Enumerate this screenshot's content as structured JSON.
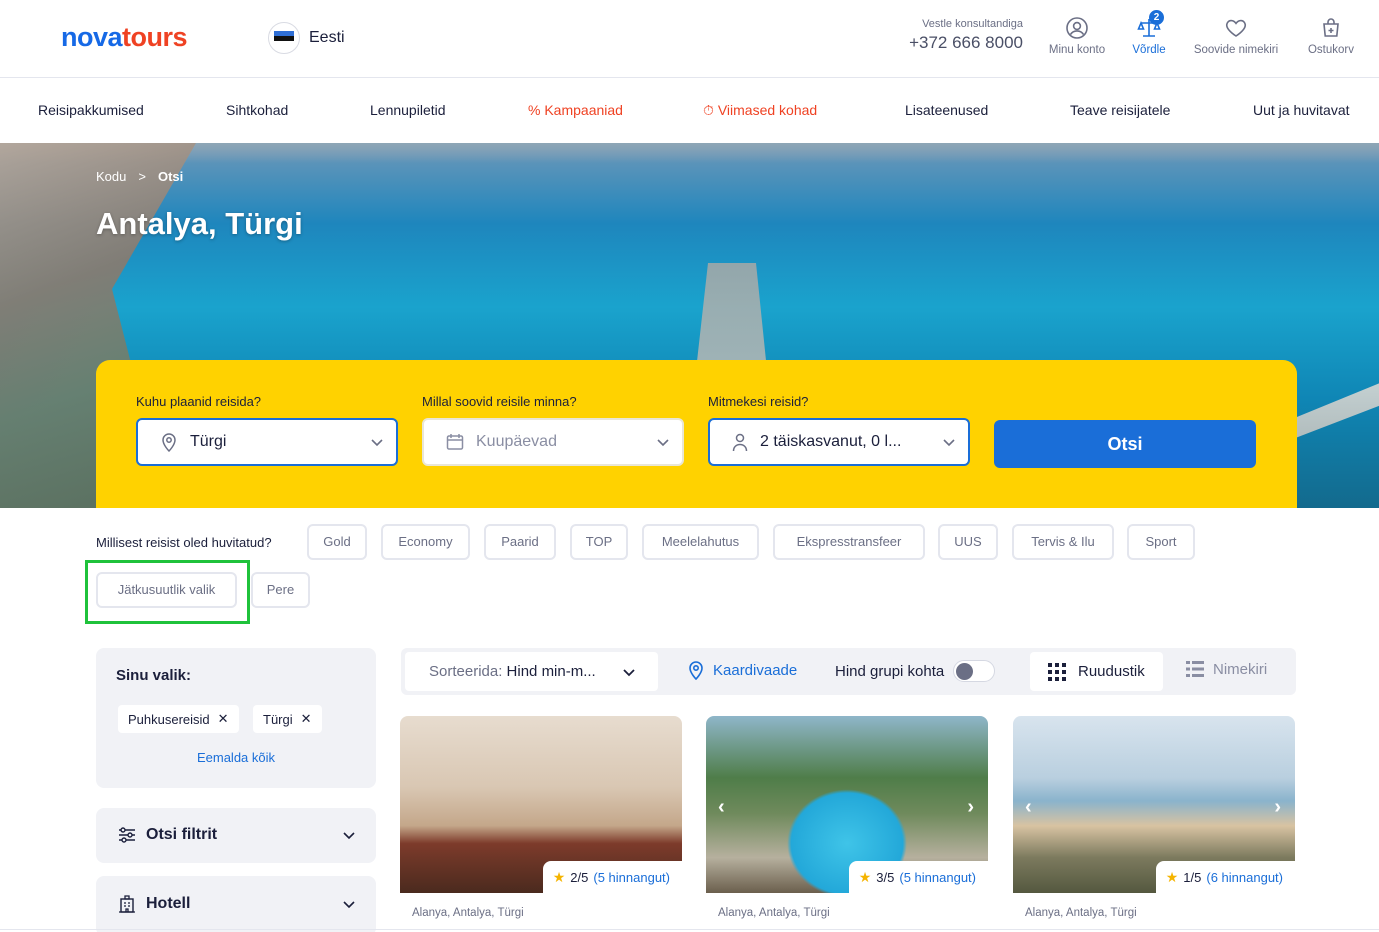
{
  "header": {
    "logo_part1": "n",
    "logo_o": "o",
    "logo_part2": "va",
    "logo_part3": "tours",
    "language": "Eesti",
    "contact_label": "Vestle konsultandiga",
    "phone": "+372 666 8000",
    "icons": [
      {
        "label": "Minu konto",
        "icon": "user-icon"
      },
      {
        "label": "Võrdle",
        "icon": "compare-icon",
        "badge": "2"
      },
      {
        "label": "Soovide nimekiri",
        "icon": "heart-icon"
      },
      {
        "label": "Ostukorv",
        "icon": "cart-icon"
      }
    ]
  },
  "nav": [
    {
      "label": "Reisipakkumised"
    },
    {
      "label": "Sihtkohad"
    },
    {
      "label": "Lennupiletid"
    },
    {
      "label": "% Kampaaniad"
    },
    {
      "label": "Viimased kohad",
      "icon": "timer-icon"
    },
    {
      "label": "Lisateenused"
    },
    {
      "label": "Teave reisijatele"
    },
    {
      "label": "Uut ja huvitavat"
    }
  ],
  "hero": {
    "breadcrumb": [
      "Kodu",
      ">",
      "Otsi"
    ],
    "title": "Antalya, Türgi"
  },
  "search": {
    "where_label": "Kuhu plaanid reisida?",
    "where_value": "Türgi",
    "when_label": "Millal soovid reisile minna?",
    "when_placeholder": "Kuupäevad",
    "who_label": "Mitmekesi reisid?",
    "who_value": "2 täiskasvanut, 0 l...",
    "submit_label": "Otsi"
  },
  "interests": {
    "question": "Millisest reisist oled huvitatud?",
    "tags": [
      "Gold",
      "Economy",
      "Paarid",
      "TOP",
      "Meelelahutus",
      "Ekspresstransfeer",
      "UUS",
      "Tervis & Ilu",
      "Sport",
      "Jätkusuutlik valik",
      "Pere"
    ]
  },
  "sidebar": {
    "chosen_title": "Sinu valik:",
    "chips": [
      "Puhkusereisid",
      "Türgi"
    ],
    "remove_all": "Eemalda kõik",
    "filters_label": "Otsi filtrit",
    "hotel_label": "Hotell"
  },
  "toolbar": {
    "sort_key": "Sorteerida:",
    "sort_value": "Hind min-m...",
    "map_label": "Kaardivaade",
    "group_price_label": "Hind grupi kohta",
    "grid_label": "Ruudustik",
    "list_label": "Nimekiri"
  },
  "cards": [
    {
      "rating": "2/5",
      "reviews": "(5 hinnangut)",
      "location": "Alanya, Antalya, Türgi"
    },
    {
      "rating": "3/5",
      "reviews": "(5 hinnangut)",
      "location": "Alanya, Antalya, Türgi"
    },
    {
      "rating": "1/5",
      "reviews": "(6 hinnangut)",
      "location": "Alanya, Antalya, Türgi"
    }
  ],
  "colors": {
    "brand_blue": "#1a6ed8",
    "brand_red": "#ef4223",
    "search_yellow": "#ffd200",
    "highlight_green": "#1fc23b"
  }
}
